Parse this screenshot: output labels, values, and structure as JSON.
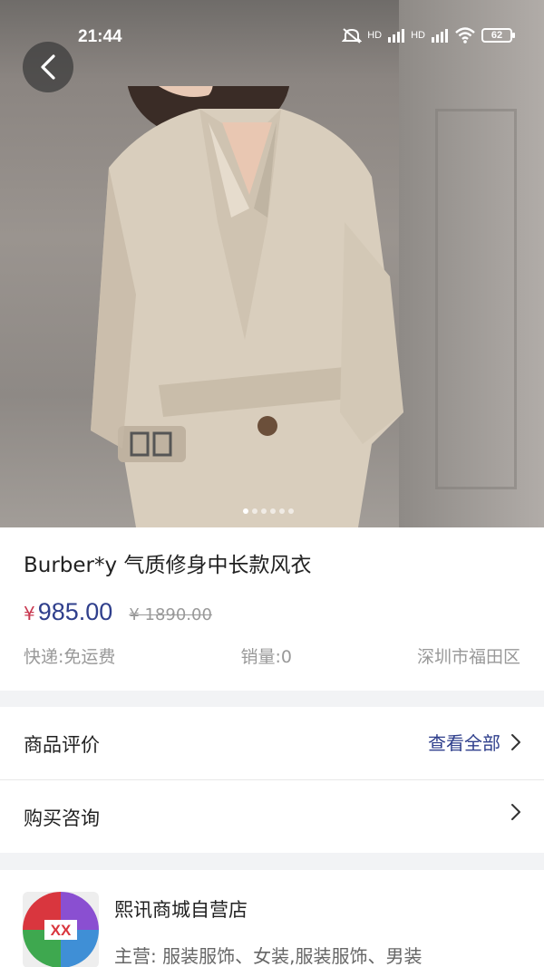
{
  "status": {
    "time": "21:44",
    "battery": "62",
    "hd1": "HD",
    "hd2": "HD"
  },
  "gallery": {
    "dot_count": 6,
    "active_index": 0
  },
  "product": {
    "title": "Burber*y 气质修身中长款风衣",
    "currency": "¥",
    "price": "985.00",
    "original_price": "¥ 1890.00",
    "shipping": "快递:免运费",
    "sales": "销量:0",
    "location": "深圳市福田区"
  },
  "reviews": {
    "label": "商品评价",
    "view_all": "查看全部"
  },
  "consult": {
    "label": "购买咨询"
  },
  "store": {
    "name": "熙讯商城自营店",
    "main_business": "主营: 服装服饰、女装,服装服饰、男装",
    "logo_text": "XX"
  },
  "colors": {
    "price": "#2f3f8c",
    "currency": "#c8374f",
    "link": "#2f3f8c"
  }
}
